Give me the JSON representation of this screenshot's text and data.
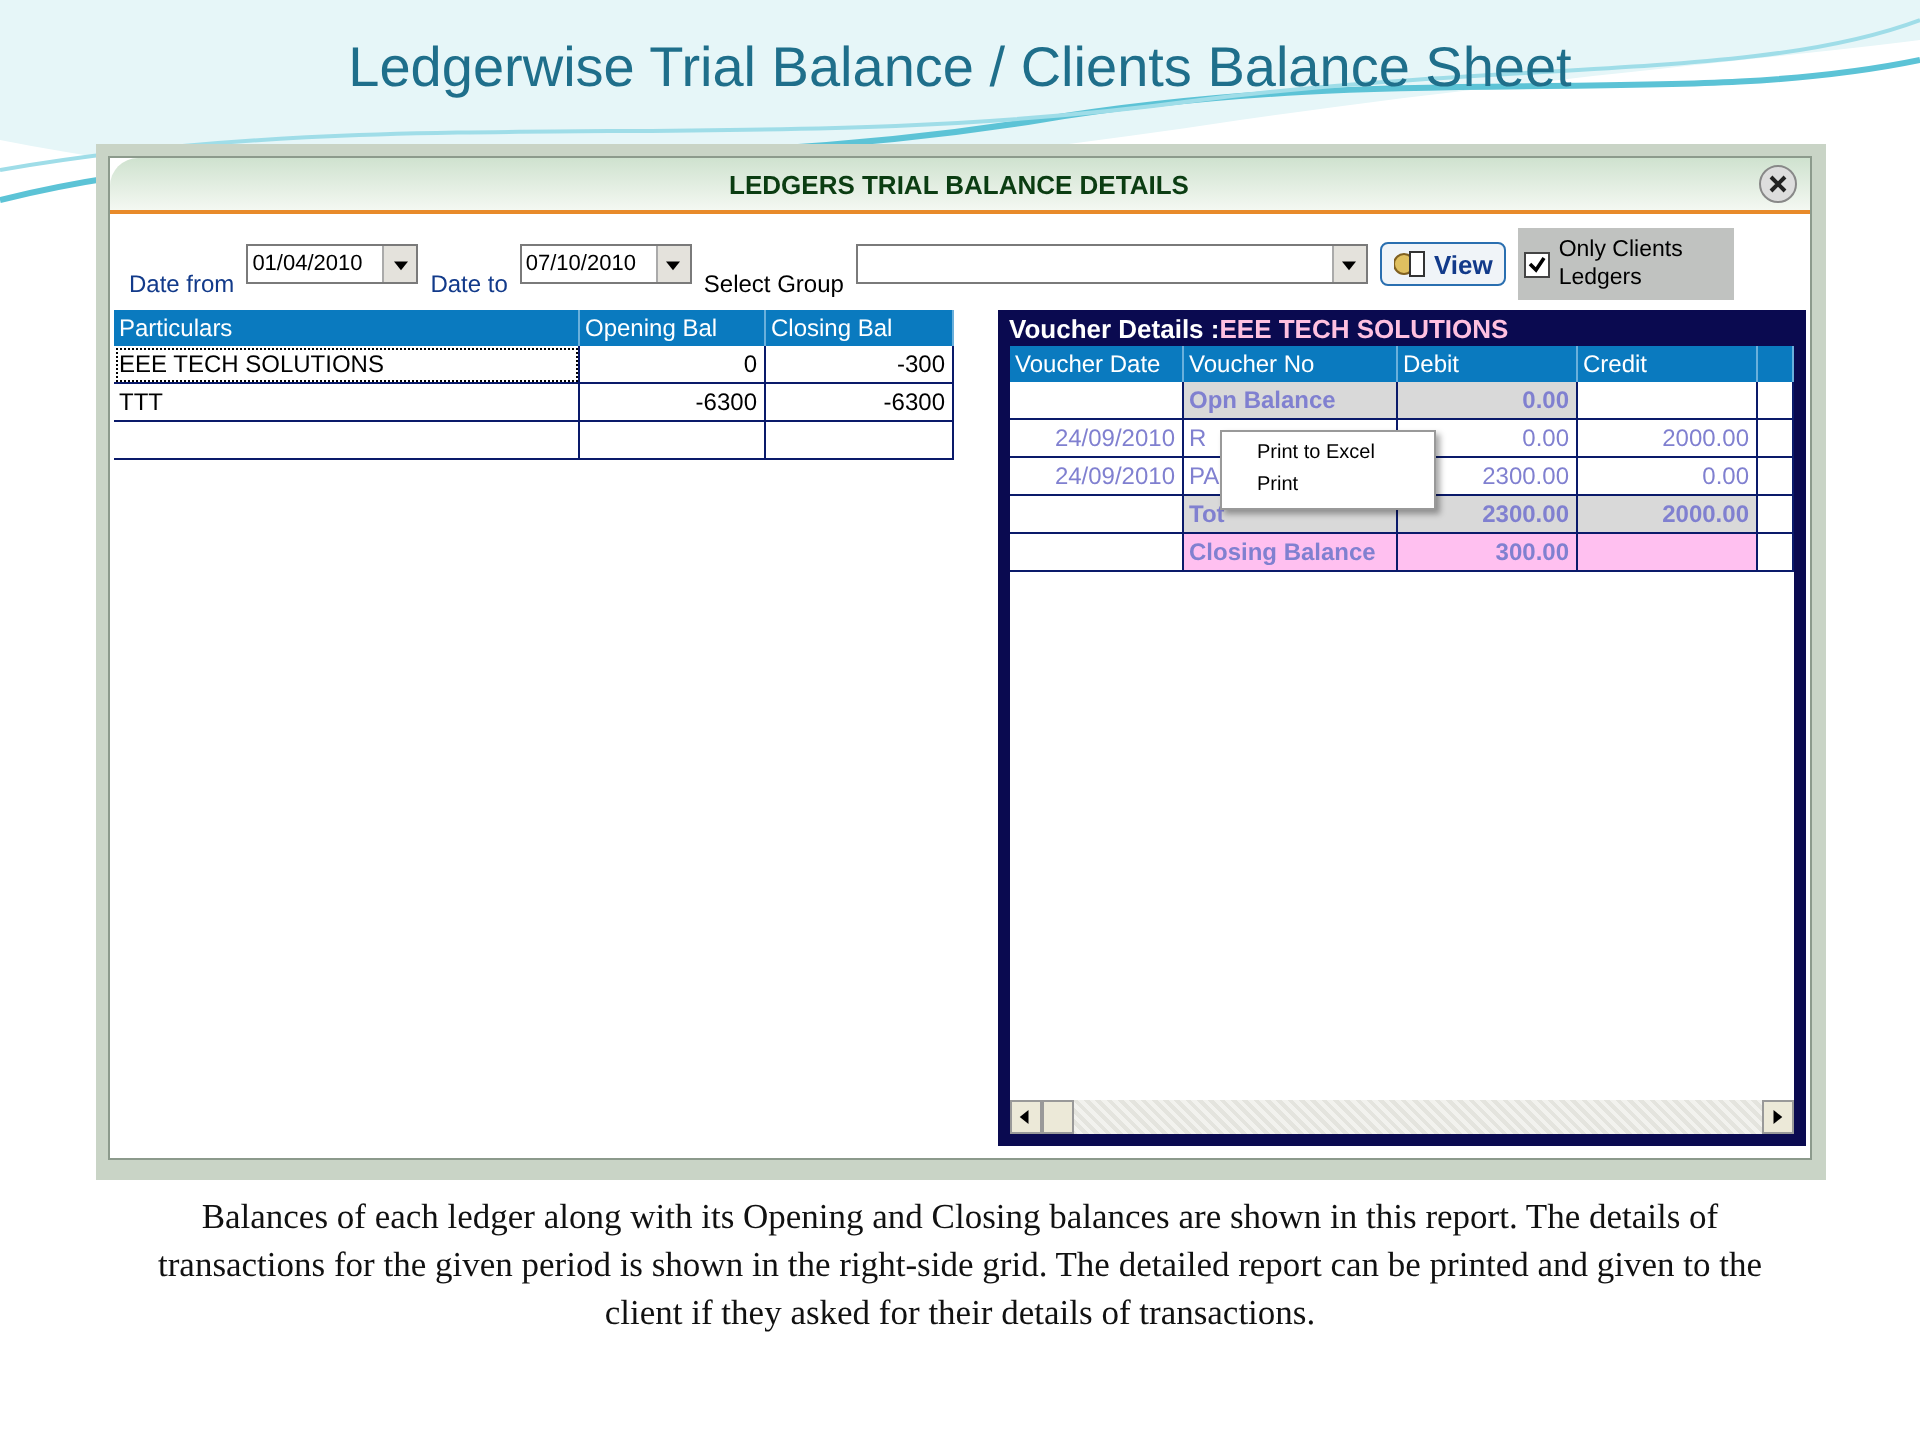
{
  "slide": {
    "title": "Ledgerwise Trial Balance / Clients Balance Sheet",
    "caption": "Balances of each ledger along with its Opening and Closing balances are shown in this report. The details of transactions for the given period is shown in the right-side grid.  The detailed report can be printed and given to the client if they asked for their details of transactions."
  },
  "window": {
    "title": "LEDGERS TRIAL BALANCE DETAILS"
  },
  "filters": {
    "date_from_label": "Date from",
    "date_from": "01/04/2010",
    "date_to_label": "Date to",
    "date_to": "07/10/2010",
    "group_label": "Select Group",
    "view_button": "View",
    "only_clients": {
      "label": "Only Clients Ledgers",
      "checked": true
    }
  },
  "ledgers": {
    "columns": [
      "Particulars",
      "Opening Bal",
      "Closing Bal"
    ],
    "rows": [
      {
        "particulars": "EEE TECH SOLUTIONS",
        "opening": "0",
        "closing": "-300",
        "selected": true
      },
      {
        "particulars": "TTT",
        "opening": "-6300",
        "closing": "-6300",
        "selected": false
      }
    ]
  },
  "vouchers": {
    "title": "Voucher Details :",
    "ledger": "EEE TECH SOLUTIONS",
    "columns": [
      "Voucher Date",
      "Voucher No",
      "Debit",
      "Credit"
    ],
    "rows": [
      {
        "kind": "opening",
        "date": "",
        "voucher": "Opn Balance",
        "debit": "0.00",
        "credit": ""
      },
      {
        "kind": "entry",
        "date": "24/09/2010",
        "voucher": "R",
        "debit": "0.00",
        "credit": "2000.00"
      },
      {
        "kind": "entry",
        "date": "24/09/2010",
        "voucher": "PA",
        "debit": "2300.00",
        "credit": "0.00"
      },
      {
        "kind": "total",
        "date": "",
        "voucher": "Tot",
        "debit": "2300.00",
        "credit": "2000.00"
      },
      {
        "kind": "closing",
        "date": "",
        "voucher": "Closing Balance",
        "debit": "300.00",
        "credit": ""
      }
    ]
  },
  "context_menu": {
    "items": [
      "Print to Excel",
      "Print"
    ]
  }
}
